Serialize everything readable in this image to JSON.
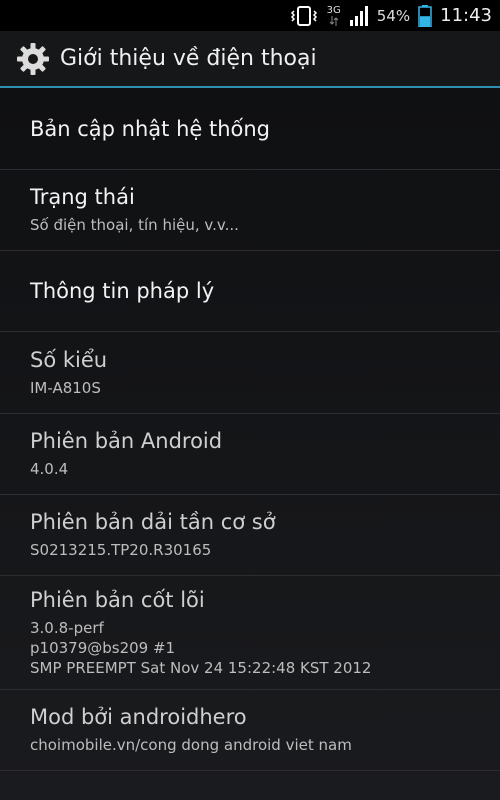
{
  "status_bar": {
    "network": "3G",
    "battery_percent_label": "54%",
    "battery_level": 0.54,
    "time": "11:43",
    "icons": [
      "vibrate-icon",
      "network-3g-icon",
      "signal-icon",
      "battery-icon"
    ]
  },
  "action_bar": {
    "title": "Giới thiệu về điện thoại",
    "icon": "settings-gear-icon"
  },
  "items": [
    {
      "title": "Bản cập nhật hệ thống",
      "subtitle": ""
    },
    {
      "title": "Trạng thái",
      "subtitle": "Số điện thoại, tín hiệu, v.v..."
    },
    {
      "title": "Thông tin pháp lý",
      "subtitle": ""
    },
    {
      "title": "Số kiểu",
      "subtitle": "IM-A810S"
    },
    {
      "title": "Phiên bản Android",
      "subtitle": "4.0.4"
    },
    {
      "title": "Phiên bản dải tần cơ sở",
      "subtitle": "S0213215.TP20.R30165"
    },
    {
      "title": "Phiên bản cốt lõi",
      "subtitle": "3.0.8-perf\np10379@bs209 #1\nSMP PREEMPT Sat Nov 24 15:22:48 KST 2012"
    },
    {
      "title": "Mod bởi androidhero",
      "subtitle": "choimobile.vn/cong dong android viet nam"
    }
  ],
  "colors": {
    "accent": "#2f8fb3",
    "battery": "#33b5e5"
  }
}
